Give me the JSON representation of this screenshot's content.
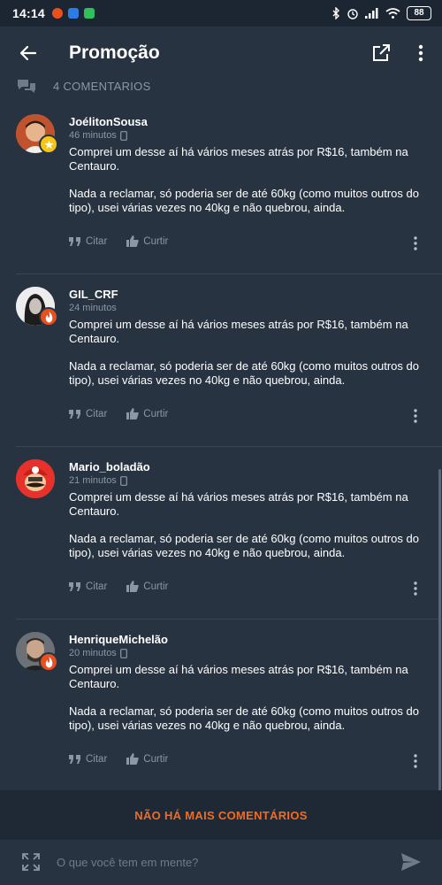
{
  "status_bar": {
    "time": "14:14",
    "battery": "88"
  },
  "header": {
    "title": "Promoção"
  },
  "comments_header": {
    "count_label": "4 COMENTARIOS"
  },
  "comments": [
    {
      "username": "JoélitonSousa",
      "time": "46 minutos",
      "paragraph1": "Comprei um desse aí há vários meses atrás por R$16, também na Centauro.",
      "paragraph2": "Nada a reclamar, só poderia ser de até 60kg (como muitos outros do tipo), usei várias vezes no 40kg e não quebrou, ainda.",
      "quote_label": "Citar",
      "like_label": "Curtir",
      "badge": "star"
    },
    {
      "username": "GIL_CRF",
      "time": "24 minutos",
      "paragraph1": "Comprei um desse aí há vários meses atrás por R$16, também na Centauro.",
      "paragraph2": "Nada a reclamar, só poderia ser de até 60kg (como muitos outros do tipo), usei várias vezes no 40kg e não quebrou, ainda.",
      "quote_label": "Citar",
      "like_label": "Curtir",
      "badge": "flame"
    },
    {
      "username": "Mario_boladão",
      "time": "21 minutos",
      "paragraph1": "Comprei um desse aí há vários meses atrás por R$16, também na Centauro.",
      "paragraph2": "Nada a reclamar, só poderia ser de até 60kg (como muitos outros do tipo), usei várias vezes no 40kg e não quebrou, ainda.",
      "quote_label": "Citar",
      "like_label": "Curtir",
      "badge": "none"
    },
    {
      "username": "HenriqueMichelão",
      "time": "20 minutos",
      "paragraph1": "Comprei um desse aí há vários meses atrás por R$16, também na Centauro.",
      "paragraph2": "Nada a reclamar, só poderia ser de até 60kg (como muitos outros do tipo), usei várias vezes no 40kg e não quebrou, ainda.",
      "quote_label": "Citar",
      "like_label": "Curtir",
      "badge": "flame"
    }
  ],
  "end_banner": {
    "label": "NÃO HÁ MAIS COMENTÁRIOS"
  },
  "composer": {
    "placeholder": "O que você tem em mente?",
    "value": ""
  },
  "colors": {
    "background": "#283341",
    "accent_orange": "#f26b22",
    "muted_text": "#8a97a6",
    "badge_star": "#f5c518",
    "badge_flame": "#e8501e"
  },
  "icons": {
    "back": "arrow-left-icon",
    "open_external": "open-in-new-icon",
    "more": "more-vertical-icon",
    "comments": "chat-bubbles-icon",
    "device": "phone-icon",
    "quote": "quote-icon",
    "like": "thumbs-up-icon",
    "expand": "expand-icon",
    "send": "send-icon"
  }
}
